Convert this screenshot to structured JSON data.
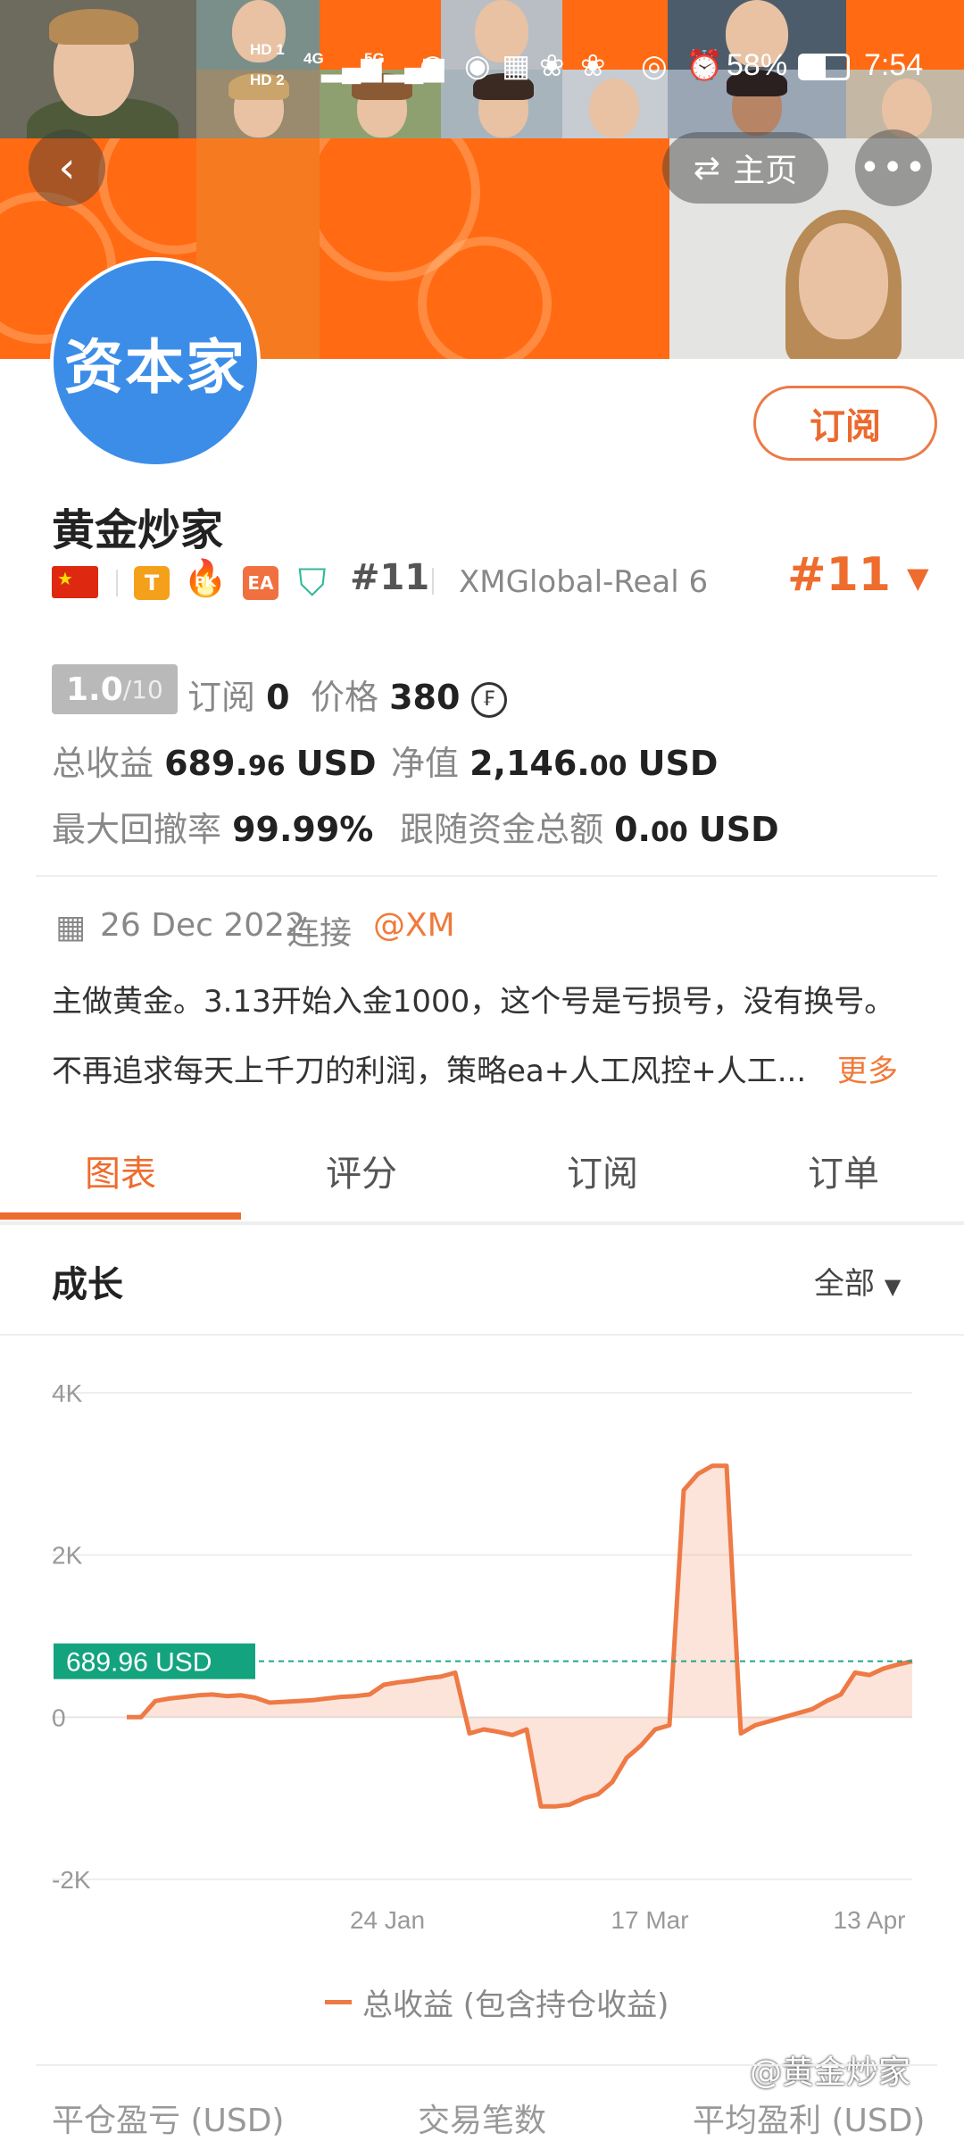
{
  "status_bar": {
    "hd1": "HD 1",
    "hd2": "HD 2",
    "net1": "4G",
    "net2": "5G",
    "battery": "58%",
    "time": "7:54"
  },
  "header": {
    "home_label": "主页"
  },
  "profile": {
    "avatar_text": "资本家",
    "name": "黄金炒家",
    "subscribe_label": "订阅",
    "rank_tag": "#11",
    "account": "XMGlobal-Real 6",
    "rank_big": "#11",
    "badges": {
      "t": "T",
      "pk": "PK",
      "ea": "EA"
    }
  },
  "stats": {
    "score": "1.0",
    "score_max": "/10",
    "subscribe_label": "订阅",
    "subscribe_count": "0",
    "price_label": "价格",
    "price": "380",
    "total_profit_label": "总收益",
    "total_profit_int": "689.",
    "total_profit_dec": "96",
    "total_profit_unit": "USD",
    "net_label": "净值",
    "net_int": "2,146.",
    "net_dec": "00",
    "net_unit": "USD",
    "drawdown_label": "最大回撤率",
    "drawdown": "99.99%",
    "follow_label": "跟随资金总额",
    "follow_int": "0.",
    "follow_dec": "00",
    "follow_unit": "USD"
  },
  "info": {
    "date": "26 Dec 2022",
    "connect_label": "连接",
    "broker": "@XM",
    "desc1": "主做黄金。3.13开始入金1000，这个号是亏损号，没有换号。",
    "desc2": "不再追求每天上千刀的利润，策略ea+人工风控+人工...",
    "more": "更多"
  },
  "tabs": [
    "图表",
    "评分",
    "订阅",
    "订单"
  ],
  "section": {
    "title": "成长",
    "filter": "全部"
  },
  "chart_data": {
    "type": "area",
    "title": "",
    "y_ticks": [
      "4K",
      "2K",
      "0",
      "-2K"
    ],
    "x_ticks": [
      "24 Jan",
      "17 Mar",
      "13 Apr"
    ],
    "ylim": [
      -2000,
      4000
    ],
    "current_label": "689.96 USD",
    "current_value": 689.96,
    "legend": "总收益 (包含持仓收益)",
    "series": [
      {
        "name": "总收益 (包含持仓收益)",
        "color": "#ee7a45",
        "values": [
          0,
          0,
          200,
          230,
          250,
          270,
          280,
          260,
          270,
          240,
          180,
          190,
          200,
          210,
          230,
          250,
          260,
          280,
          400,
          430,
          450,
          480,
          500,
          550,
          -200,
          -150,
          -180,
          -220,
          -150,
          -1100,
          -1100,
          -1080,
          -1000,
          -950,
          -800,
          -500,
          -350,
          -150,
          -100,
          2800,
          3000,
          3100,
          3100,
          -200,
          -100,
          -50,
          0,
          50,
          100,
          200,
          280,
          550,
          520,
          600,
          650,
          689.96
        ]
      }
    ]
  },
  "watermark": "@黄金炒家",
  "bottom_labels": [
    "平仓盈亏 (USD)",
    "交易笔数",
    "平均盈利 (USD)"
  ]
}
